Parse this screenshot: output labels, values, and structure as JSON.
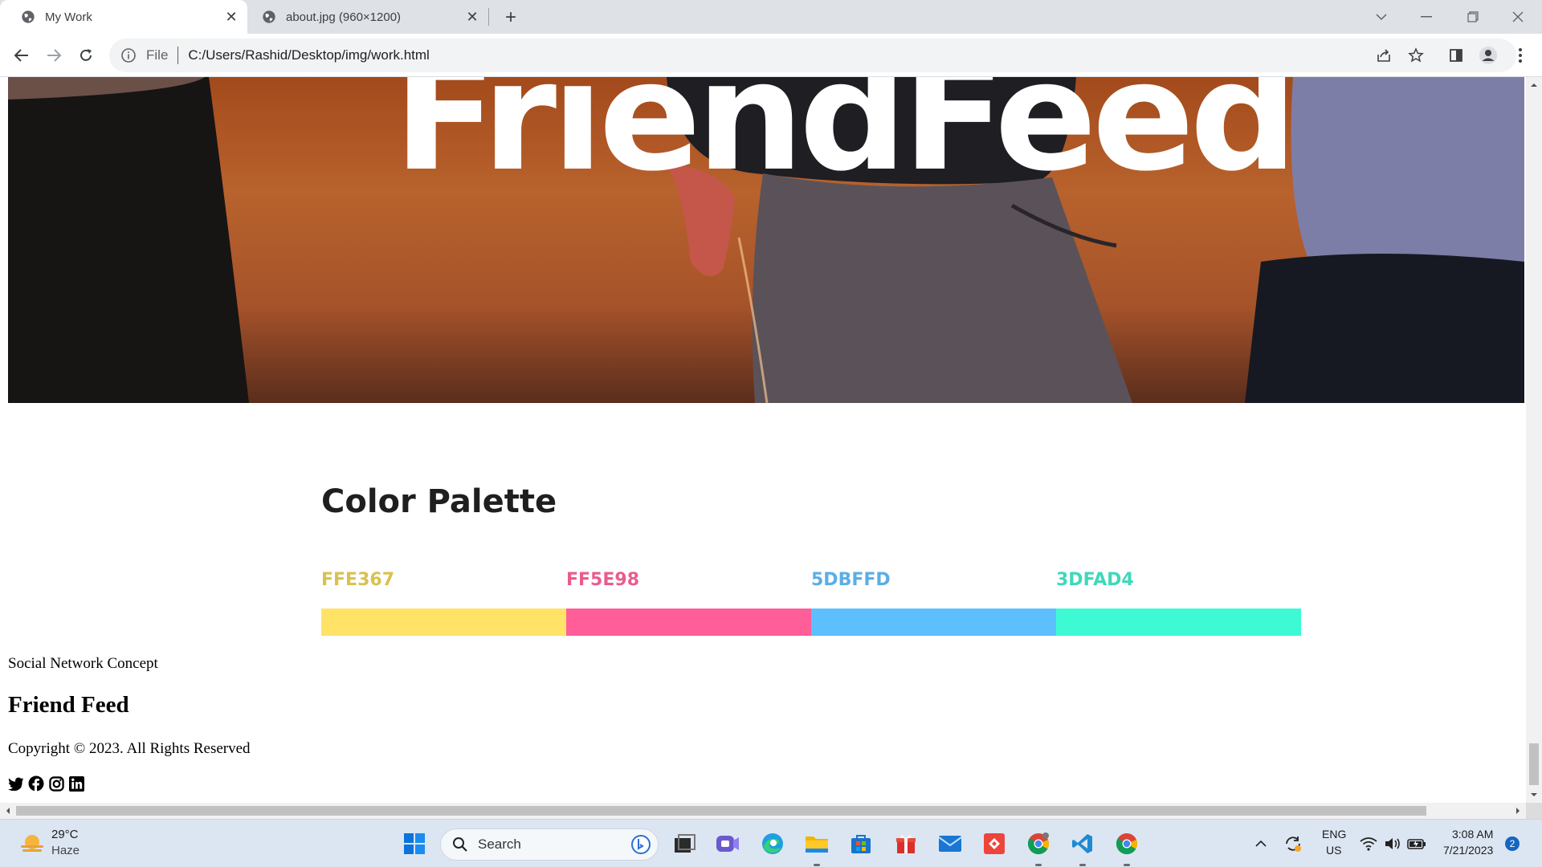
{
  "browser": {
    "tabs": [
      {
        "title": "My Work",
        "active": true
      },
      {
        "title": "about.jpg (960×1200)",
        "active": false
      }
    ],
    "address": {
      "scheme_label": "File",
      "url": "C:/Users/Rashid/Desktop/img/work.html"
    }
  },
  "page": {
    "hero_title": "FriendFeed",
    "palette": {
      "heading": "Color Palette",
      "swatches": [
        {
          "code": "FFE367",
          "color": "#FFE367",
          "label_color": "#d8c24e"
        },
        {
          "code": "FF5E98",
          "color": "#FF5E98",
          "label_color": "#e85d8f"
        },
        {
          "code": "5DBFFD",
          "color": "#5DBFFD",
          "label_color": "#5aaee6"
        },
        {
          "code": "3DFAD4",
          "color": "#3DFAD4",
          "label_color": "#3fd8bb"
        }
      ]
    },
    "footer": {
      "concept": "Social Network Concept",
      "title": "Friend Feed",
      "copyright": "Copyright © 2023. All Rights Reserved",
      "social_icons": [
        "twitter-icon",
        "facebook-icon",
        "instagram-icon",
        "linkedin-icon"
      ]
    }
  },
  "taskbar": {
    "weather": {
      "temp": "29°C",
      "condition": "Haze"
    },
    "search_label": "Search",
    "language": {
      "line1": "ENG",
      "line2": "US"
    },
    "clock": {
      "time": "3:08 AM",
      "date": "7/21/2023"
    },
    "notification_count": "2"
  }
}
